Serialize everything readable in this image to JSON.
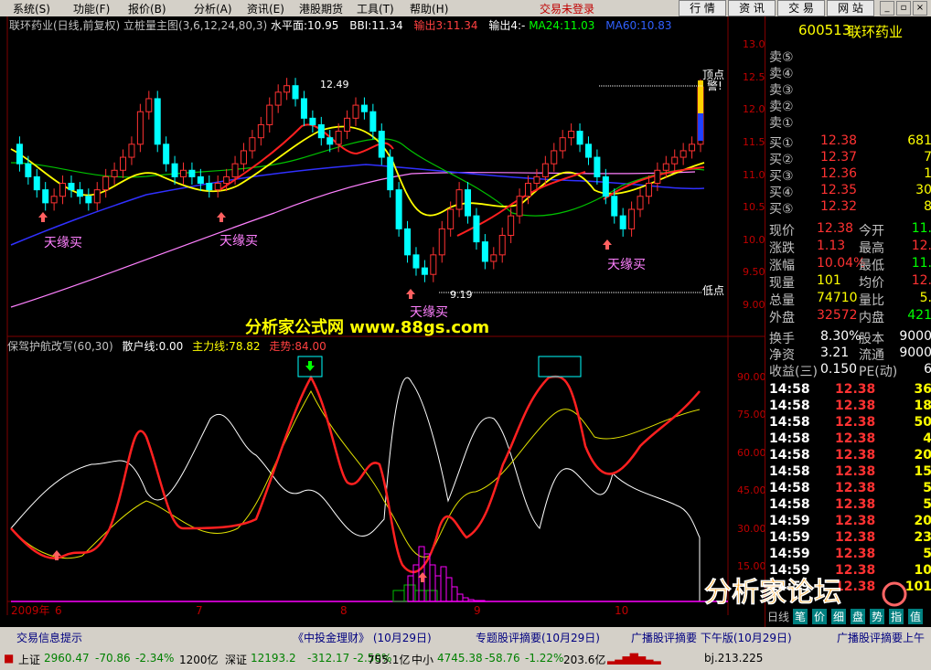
{
  "menu": {
    "items": [
      "系统(S)",
      "功能(F)",
      "报价(B)",
      "分析(A)",
      "资讯(E)",
      "港股期货",
      "工具(T)",
      "帮助(H)"
    ],
    "trade_status": "交易未登录",
    "right_buttons": [
      "行 情",
      "资 讯",
      "交 易",
      "网 站"
    ]
  },
  "chart_header": {
    "title": "联环药业(日线,前复权)",
    "indicator": "立桩量主图(3,6,12,24,80,3)",
    "level": "水平面:10.95",
    "bbi": "BBI:11.34",
    "out3": "输出3:11.34",
    "out4": "输出4:-",
    "ma24": "MA24:11.03",
    "ma60": "MA60:10.83"
  },
  "price_axis": [
    "13.00",
    "12.50",
    "12.00",
    "11.50",
    "11.00",
    "10.50",
    "10.00",
    "9.50",
    "9.00"
  ],
  "indicator_axis": [
    "90.00",
    "75.00",
    "60.00",
    "45.00",
    "30.00",
    "15.00"
  ],
  "annotations": {
    "high_price": "12.49",
    "low_price": "9.19",
    "buy_labels": [
      "天缘买",
      "天缘买",
      "天缘买",
      "天缘买"
    ],
    "top_point": "顶点",
    "top_point2": "警!",
    "low_point": "低点",
    "watermark_site": "分析家公式网 www.88gs.com"
  },
  "indicator_header": {
    "name": "保驾护航改写(60,30)",
    "retail": "散户线:0.00",
    "main_force": "主力线:78.82",
    "trend": "走势:84.00"
  },
  "date_axis": [
    "2009年",
    "6",
    "7",
    "8",
    "9",
    "10"
  ],
  "quote": {
    "code": "600513",
    "name": "联环药业",
    "sell_labels": [
      "卖⑤",
      "卖④",
      "卖③",
      "卖②",
      "卖①"
    ],
    "buy_orders": [
      {
        "label": "买①",
        "price": "12.38",
        "vol": "681"
      },
      {
        "label": "买②",
        "price": "12.37",
        "vol": "7"
      },
      {
        "label": "买③",
        "price": "12.36",
        "vol": "1"
      },
      {
        "label": "买④",
        "price": "12.35",
        "vol": "30"
      },
      {
        "label": "买⑤",
        "price": "12.32",
        "vol": "8"
      }
    ],
    "stats": [
      {
        "l1": "现价",
        "v1": "12.38",
        "l2": "今开",
        "v2": "11."
      },
      {
        "l1": "涨跌",
        "v1": "1.13",
        "l2": "最高",
        "v2": "12."
      },
      {
        "l1": "涨幅",
        "v1": "10.04%",
        "l2": "最低",
        "v2": "11."
      },
      {
        "l1": "现量",
        "v1": "101",
        "l2": "均价",
        "v2": "12."
      },
      {
        "l1": "总量",
        "v1": "74710",
        "l2": "量比",
        "v2": "5."
      },
      {
        "l1": "外盘",
        "v1": "32572",
        "l2": "内盘",
        "v2": "421"
      }
    ],
    "stats2": [
      {
        "l1": "换手",
        "v1": "8.30%",
        "l2": "股本",
        "v2": "9000"
      },
      {
        "l1": "净资",
        "v1": "3.21",
        "l2": "流通",
        "v2": "9000"
      },
      {
        "l1": "收益(三)",
        "v1": "0.150",
        "l2": "PE(动)",
        "v2": "6"
      }
    ],
    "ticks": [
      {
        "time": "14:58",
        "price": "12.38",
        "vol": "36"
      },
      {
        "time": "14:58",
        "price": "12.38",
        "vol": "18"
      },
      {
        "time": "14:58",
        "price": "12.38",
        "vol": "50"
      },
      {
        "time": "14:58",
        "price": "12.38",
        "vol": "4"
      },
      {
        "time": "14:58",
        "price": "12.38",
        "vol": "20"
      },
      {
        "time": "14:58",
        "price": "12.38",
        "vol": "15"
      },
      {
        "time": "14:58",
        "price": "12.38",
        "vol": "5"
      },
      {
        "time": "14:58",
        "price": "12.38",
        "vol": "5"
      },
      {
        "time": "14:59",
        "price": "12.38",
        "vol": "20"
      },
      {
        "time": "14:59",
        "price": "12.38",
        "vol": "23"
      },
      {
        "time": "14:59",
        "price": "12.38",
        "vol": "5"
      },
      {
        "time": "14:59",
        "price": "12.38",
        "vol": "10"
      },
      {
        "time": "14:59",
        "price": "12.38",
        "vol": "101"
      }
    ],
    "tabs": [
      "日线",
      "笔",
      "价",
      "细",
      "盘",
      "势",
      "指",
      "值"
    ]
  },
  "news": {
    "label": "交易信息提示",
    "items": [
      "《中投金理财》 (10月29日)",
      "专题股评摘要(10月29日)",
      "广播股评摘要 下午版(10月29日)",
      "广播股评摘要上午版"
    ]
  },
  "indices": {
    "sh": {
      "name": "上证",
      "value": "2960.47",
      "chg": "-70.86",
      "pct": "-2.34%",
      "amt": "1200亿"
    },
    "sz": {
      "name": "深证",
      "value": "12193.2",
      "chg": "-312.17",
      "pct": "-2.50%",
      "amt": "755.1亿"
    },
    "zx": {
      "name": "中小",
      "value": "4745.38",
      "chg": "-58.76",
      "pct": "-1.22%",
      "amt": "203.6亿"
    },
    "server": "bj.213.225"
  },
  "forum_watermark": "分析家论坛",
  "colors": {
    "up": "#ff3232",
    "down": "#00ffff",
    "yellow": "#ffff00",
    "magenta": "#ff00ff",
    "green": "#00ff00"
  }
}
